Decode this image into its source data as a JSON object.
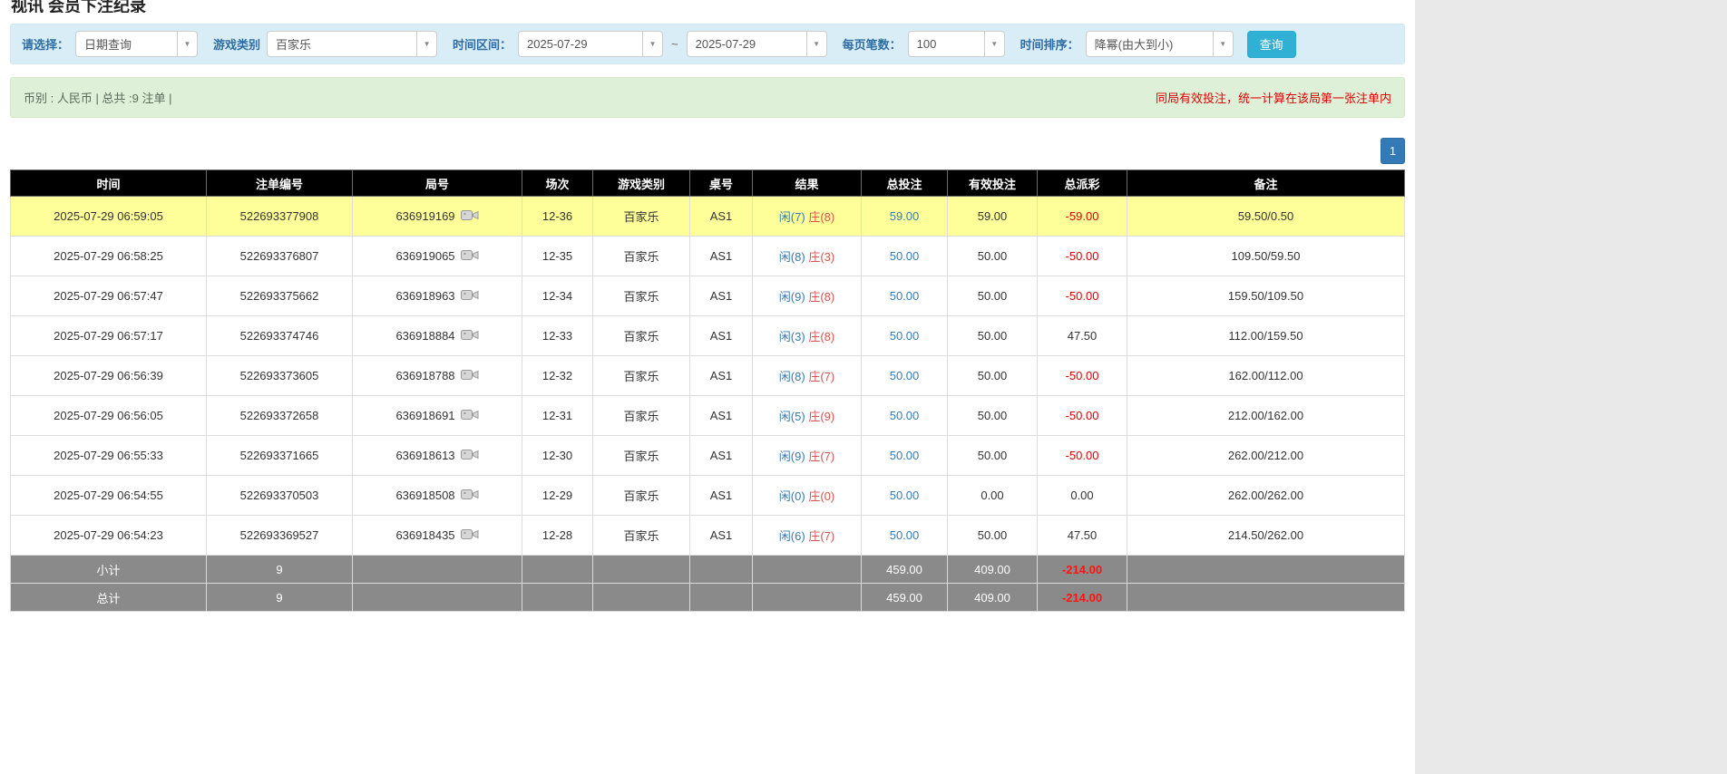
{
  "page": {
    "title": "视讯 会员下注纪录"
  },
  "icons": {
    "chevron": "▼"
  },
  "filters": {
    "select_label": "请选择：",
    "select_value": "日期查询",
    "game_type_label": "游戏类别",
    "game_type_value": "百家乐",
    "time_range_label": "时间区间：",
    "date_from": "2025-07-29",
    "tilde": "~",
    "date_to": "2025-07-29",
    "per_page_label": "每页笔数：",
    "per_page_value": "100",
    "sort_label": "时间排序：",
    "sort_value": "降幂(由大到小)",
    "search_button": "查询"
  },
  "summary": {
    "left": "币别 : 人民币 | 总共 :9 注单 |",
    "right": "同局有效投注，统一计算在该局第一张注单内"
  },
  "pagination": {
    "current": "1"
  },
  "table": {
    "headers": [
      "时间",
      "注单编号",
      "局号",
      "场次",
      "游戏类别",
      "桌号",
      "结果",
      "总投注",
      "有效投注",
      "总派彩",
      "备注"
    ],
    "rows": [
      {
        "time": "2025-07-29 06:59:05",
        "bet_id": "522693377908",
        "round_id": "636919169",
        "session": "12-36",
        "game": "百家乐",
        "table_no": "AS1",
        "player": "闲(7)",
        "banker": "庄(8)",
        "total_bet": "59.00",
        "valid_bet": "59.00",
        "payout": "-59.00",
        "note": "59.50/0.50",
        "highlighted": true
      },
      {
        "time": "2025-07-29 06:58:25",
        "bet_id": "522693376807",
        "round_id": "636919065",
        "session": "12-35",
        "game": "百家乐",
        "table_no": "AS1",
        "player": "闲(8)",
        "banker": "庄(3)",
        "total_bet": "50.00",
        "valid_bet": "50.00",
        "payout": "-50.00",
        "note": "109.50/59.50",
        "highlighted": false
      },
      {
        "time": "2025-07-29 06:57:47",
        "bet_id": "522693375662",
        "round_id": "636918963",
        "session": "12-34",
        "game": "百家乐",
        "table_no": "AS1",
        "player": "闲(9)",
        "banker": "庄(8)",
        "total_bet": "50.00",
        "valid_bet": "50.00",
        "payout": "-50.00",
        "note": "159.50/109.50",
        "highlighted": false
      },
      {
        "time": "2025-07-29 06:57:17",
        "bet_id": "522693374746",
        "round_id": "636918884",
        "session": "12-33",
        "game": "百家乐",
        "table_no": "AS1",
        "player": "闲(3)",
        "banker": "庄(8)",
        "total_bet": "50.00",
        "valid_bet": "50.00",
        "payout": "47.50",
        "note": "112.00/159.50",
        "highlighted": false
      },
      {
        "time": "2025-07-29 06:56:39",
        "bet_id": "522693373605",
        "round_id": "636918788",
        "session": "12-32",
        "game": "百家乐",
        "table_no": "AS1",
        "player": "闲(8)",
        "banker": "庄(7)",
        "total_bet": "50.00",
        "valid_bet": "50.00",
        "payout": "-50.00",
        "note": "162.00/112.00",
        "highlighted": false
      },
      {
        "time": "2025-07-29 06:56:05",
        "bet_id": "522693372658",
        "round_id": "636918691",
        "session": "12-31",
        "game": "百家乐",
        "table_no": "AS1",
        "player": "闲(5)",
        "banker": "庄(9)",
        "total_bet": "50.00",
        "valid_bet": "50.00",
        "payout": "-50.00",
        "note": "212.00/162.00",
        "highlighted": false
      },
      {
        "time": "2025-07-29 06:55:33",
        "bet_id": "522693371665",
        "round_id": "636918613",
        "session": "12-30",
        "game": "百家乐",
        "table_no": "AS1",
        "player": "闲(9)",
        "banker": "庄(7)",
        "total_bet": "50.00",
        "valid_bet": "50.00",
        "payout": "-50.00",
        "note": "262.00/212.00",
        "highlighted": false
      },
      {
        "time": "2025-07-29 06:54:55",
        "bet_id": "522693370503",
        "round_id": "636918508",
        "session": "12-29",
        "game": "百家乐",
        "table_no": "AS1",
        "player": "闲(0)",
        "banker": "庄(0)",
        "total_bet": "50.00",
        "valid_bet": "0.00",
        "payout": "0.00",
        "note": "262.00/262.00",
        "highlighted": false
      },
      {
        "time": "2025-07-29 06:54:23",
        "bet_id": "522693369527",
        "round_id": "636918435",
        "session": "12-28",
        "game": "百家乐",
        "table_no": "AS1",
        "player": "闲(6)",
        "banker": "庄(7)",
        "total_bet": "50.00",
        "valid_bet": "50.00",
        "payout": "47.50",
        "note": "214.50/262.00",
        "highlighted": false
      }
    ],
    "subtotal": {
      "label": "小计",
      "count": "9",
      "total_bet": "459.00",
      "valid_bet": "409.00",
      "payout": "-214.00"
    },
    "total": {
      "label": "总计",
      "count": "9",
      "total_bet": "459.00",
      "valid_bet": "409.00",
      "payout": "-214.00"
    }
  }
}
